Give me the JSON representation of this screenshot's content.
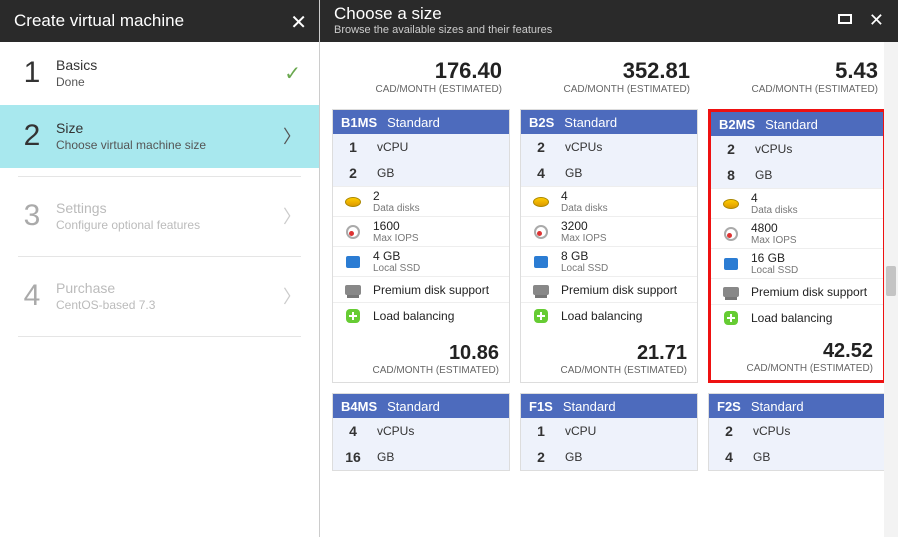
{
  "wizard": {
    "title": "Create virtual machine",
    "steps": [
      {
        "num": "1",
        "title": "Basics",
        "sub": "Done",
        "state": "done"
      },
      {
        "num": "2",
        "title": "Size",
        "sub": "Choose virtual machine size",
        "state": "active"
      },
      {
        "num": "3",
        "title": "Settings",
        "sub": "Configure optional features",
        "state": "disabled"
      },
      {
        "num": "4",
        "title": "Purchase",
        "sub": "CentOS-based 7.3",
        "state": "disabled"
      }
    ]
  },
  "sizes_panel": {
    "title": "Choose a size",
    "subtitle": "Browse the available sizes and their features",
    "price_desc": "CAD/MONTH (ESTIMATED)",
    "top_prices": [
      "176.40",
      "352.81",
      "5.43"
    ],
    "feature_labels": {
      "data_disks": "Data disks",
      "max_iops": "Max IOPS",
      "local_ssd": "Local SSD",
      "premium": "Premium disk support",
      "lb": "Load balancing"
    },
    "cards": [
      {
        "sku": "B1MS",
        "tier": "Standard",
        "highlight": false,
        "vcpu_n": "1",
        "vcpu_l": "vCPU",
        "mem_n": "2",
        "mem_l": "GB",
        "disks": "2",
        "iops": "1600",
        "ssd": "4 GB",
        "price": "10.86"
      },
      {
        "sku": "B2S",
        "tier": "Standard",
        "highlight": false,
        "vcpu_n": "2",
        "vcpu_l": "vCPUs",
        "mem_n": "4",
        "mem_l": "GB",
        "disks": "4",
        "iops": "3200",
        "ssd": "8 GB",
        "price": "21.71"
      },
      {
        "sku": "B2MS",
        "tier": "Standard",
        "highlight": true,
        "vcpu_n": "2",
        "vcpu_l": "vCPUs",
        "mem_n": "8",
        "mem_l": "GB",
        "disks": "4",
        "iops": "4800",
        "ssd": "16 GB",
        "price": "42.52"
      },
      {
        "sku": "B4MS",
        "tier": "Standard",
        "highlight": false,
        "vcpu_n": "4",
        "vcpu_l": "vCPUs",
        "mem_n": "16",
        "mem_l": "GB"
      },
      {
        "sku": "F1S",
        "tier": "Standard",
        "highlight": false,
        "vcpu_n": "1",
        "vcpu_l": "vCPU",
        "mem_n": "2",
        "mem_l": "GB"
      },
      {
        "sku": "F2S",
        "tier": "Standard",
        "highlight": false,
        "vcpu_n": "2",
        "vcpu_l": "vCPUs",
        "mem_n": "4",
        "mem_l": "GB"
      }
    ]
  }
}
